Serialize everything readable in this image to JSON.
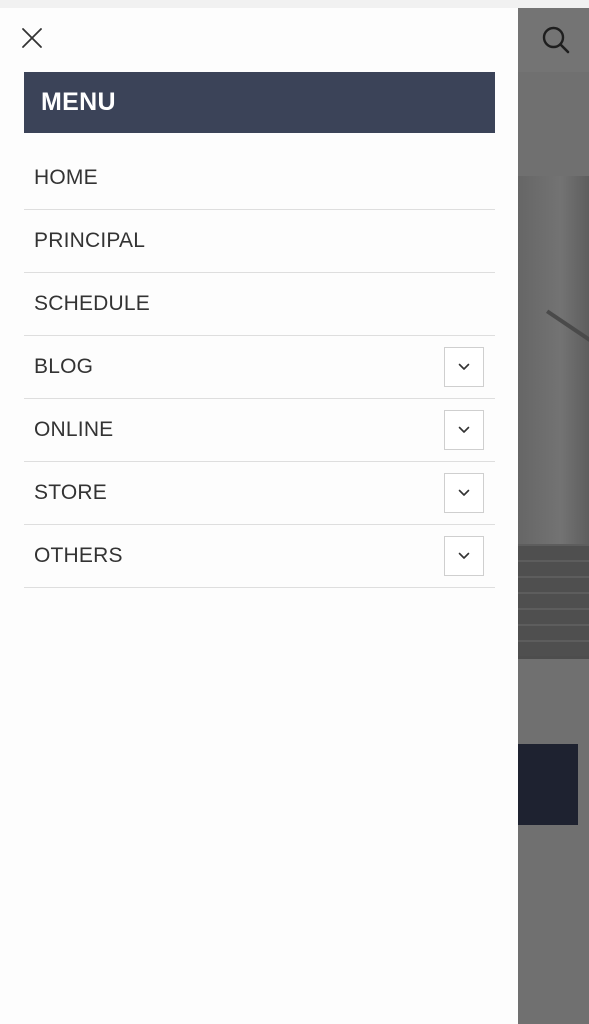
{
  "drawer": {
    "title": "MENU",
    "items": [
      {
        "label": "HOME",
        "expandable": false
      },
      {
        "label": "PRINCIPAL",
        "expandable": false
      },
      {
        "label": "SCHEDULE",
        "expandable": false
      },
      {
        "label": "BLOG",
        "expandable": true
      },
      {
        "label": "ONLINE",
        "expandable": true
      },
      {
        "label": "STORE",
        "expandable": true
      },
      {
        "label": "OTHERS",
        "expandable": true
      }
    ]
  },
  "icons": {
    "close": "close-icon",
    "search": "search-icon",
    "expand": "chevron-down-icon"
  },
  "colors": {
    "menu_header_bg": "#3b4358",
    "overlay": "#707070",
    "drawer_bg": "#fdfdfd"
  }
}
